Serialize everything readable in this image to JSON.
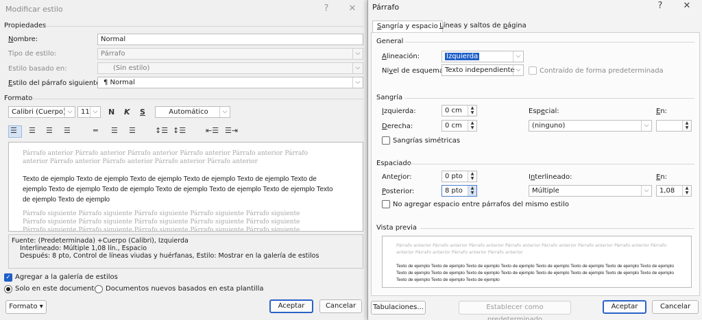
{
  "left_dialog": {
    "title": "Modificar estilo",
    "help": "?",
    "close": "✕",
    "props_header": "Propiedades",
    "name_label": "Nombre:",
    "name_value": "Normal",
    "type_label": "Tipo de estilo:",
    "type_value": "Párrafo",
    "based_label": "Estilo basado en:",
    "based_value": "(Sin estilo)",
    "next_label": "Estilo del párrafo siguiente:",
    "next_value": "¶ Normal",
    "format_header": "Formato",
    "font": "Calibri (Cuerpo)",
    "size": "11",
    "bold": "N",
    "italic": "K",
    "underline": "S",
    "color": "Automático",
    "preview_prev": "Párrafo anterior Párrafo anterior Párrafo anterior Párrafo anterior Párrafo anterior Párrafo anterior Párrafo anterior Párrafo anterior Párrafo anterior Párrafo anterior",
    "preview_sample": "Texto de ejemplo Texto de ejemplo Texto de ejemplo Texto de ejemplo Texto de ejemplo Texto de ejemplo Texto de ejemplo Texto de ejemplo Texto de ejemplo Texto de ejemplo Texto de ejemplo Texto de ejemplo Texto de ejemplo",
    "preview_next": "Párrafo siguiente Párrafo siguiente Párrafo siguiente Párrafo siguiente Párrafo siguiente Párrafo siguiente Párrafo siguiente Párrafo siguiente Párrafo siguiente Párrafo siguiente Párrafo siguiente Párrafo siguiente Párrafo siguiente Párrafo siguiente Párrafo siguiente Párrafo siguiente Párrafo siguiente",
    "desc_line1": "Fuente: (Predeterminada) +Cuerpo (Calibri), Izquierda",
    "desc_line2": "Interlineado:  Múltiple 1,08 lín., Espacio",
    "desc_line3": "Después:  8 pto, Control de líneas viudas y huérfanas, Estilo: Mostrar en la galería de estilos",
    "add_gallery": "Agregar a la galería de estilos",
    "only_doc": "Solo en este documento",
    "new_docs": "Documentos nuevos basados en esta plantilla",
    "format_btn": "Formato ▾",
    "ok": "Aceptar",
    "cancel": "Cancelar"
  },
  "right_dialog": {
    "title": "Párrafo",
    "help": "?",
    "close": "✕",
    "tab1": "Sangría y espacio",
    "tab2": "Líneas y saltos de página",
    "general": "General",
    "align_label": "Alineación:",
    "align_value": "Izquierda",
    "outline_label": "Nivel de esquema:",
    "outline_value": "Texto independiente",
    "collapsed": "Contraído de forma predeterminada",
    "indent": "Sangría",
    "left_label": "Izquierda:",
    "left_value": "0 cm",
    "right_label": "Derecha:",
    "right_value": "0 cm",
    "special_label": "Especial:",
    "special_value": "(ninguno)",
    "by_label": "En:",
    "mirror": "Sangrías simétricas",
    "spacing": "Espaciado",
    "before_label": "Anterior:",
    "before_value": "0 pto",
    "after_label": "Posterior:",
    "after_value": "8 pto",
    "line_label": "Interlineado:",
    "line_value": "Múltiple",
    "at_label": "En:",
    "at_value": "1,08",
    "no_space": "No agregar espacio entre párrafos del mismo estilo",
    "preview": "Vista previa",
    "prev_prev": "Párrafo anterior Párrafo anterior Párrafo anterior Párrafo anterior Párrafo anterior Párrafo anterior Párrafo anterior Párrafo anterior Párrafo anterior Párrafo anterior Párrafo anterior",
    "prev_sample": "Texto de ejemplo Texto de ejemplo Texto de ejemplo Texto de ejemplo Texto de ejemplo Texto de ejemplo Texto de ejemplo Texto de ejemplo Texto de ejemplo Texto de ejemplo Texto de ejemplo Texto de ejemplo Texto de ejemplo Texto de ejemplo Texto de ejemplo Texto de ejemplo Texto de ejemplo Texto de ejemplo Texto de ejemplo",
    "tabs_btn": "Tabulaciones...",
    "default_btn": "Establecer como predeterminado",
    "ok": "Aceptar",
    "cancel": "Cancelar"
  }
}
